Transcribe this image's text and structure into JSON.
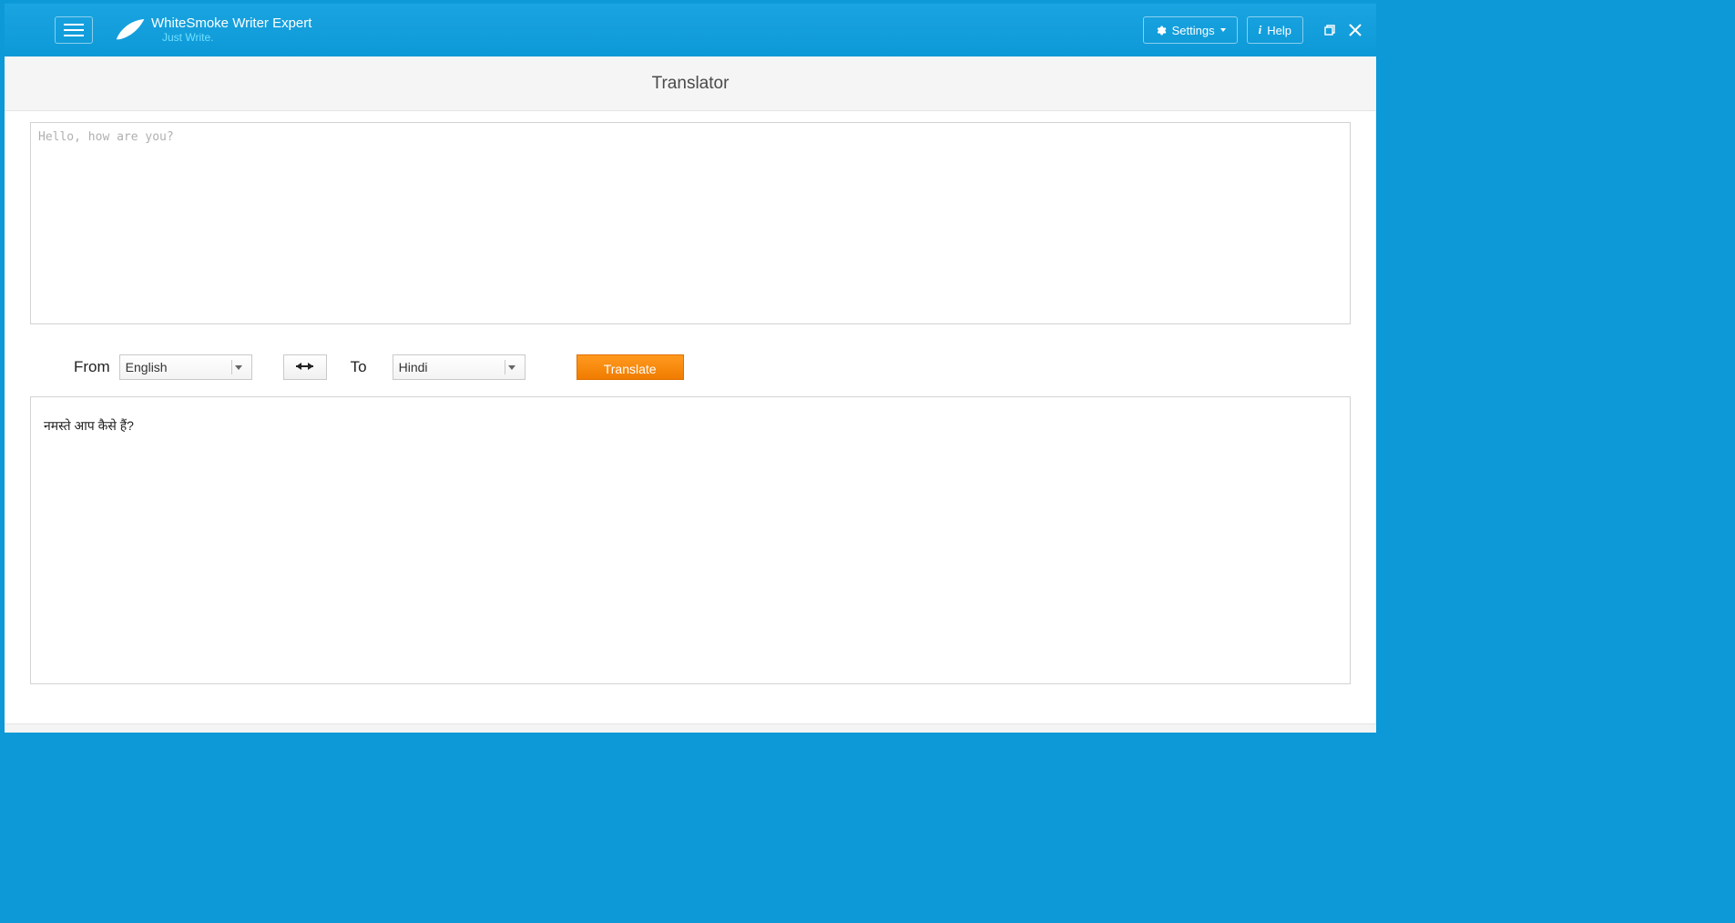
{
  "header": {
    "app_title": "WhiteSmoke Writer Expert",
    "tagline": "Just Write.",
    "settings_label": "Settings",
    "help_label": "Help"
  },
  "page": {
    "title": "Translator"
  },
  "translator": {
    "input_placeholder": "Hello, how are you?",
    "from_label": "From",
    "from_language": "English",
    "to_label": "To",
    "to_language": "Hindi",
    "translate_button": "Translate",
    "output_text": "नमस्ते आप कैसे हैं?"
  },
  "colors": {
    "brand_blue": "#0d99d7",
    "accent_orange": "#f58a00"
  }
}
